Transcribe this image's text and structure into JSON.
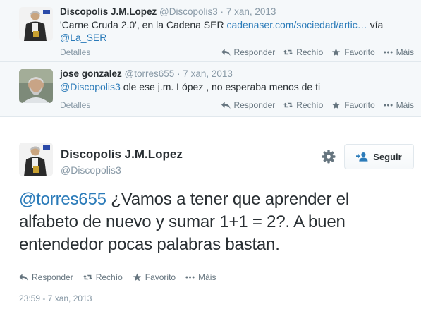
{
  "context_tweets": [
    {
      "fullname": "Discopolis J.M.Lopez",
      "username": "@Discopolis3",
      "separator": "·",
      "time": "7 xan, 2013",
      "text_prefix": "'Carne Cruda 2.0', en la Cadena SER ",
      "link": "cadenaser.com/sociedad/artic…",
      "text_via": " vía",
      "mention": "@La_SER",
      "details": "Detalles",
      "actions": {
        "reply": "Responder",
        "retweet": "Rechío",
        "favorite": "Favorito",
        "more": "Máis"
      }
    },
    {
      "fullname": "jose gonzalez",
      "username": "@torres655",
      "separator": "·",
      "time": "7 xan, 2013",
      "mention": "@Discopolis3",
      "text": " ole ese j.m. López , no esperaba menos de ti",
      "details": "Detalles",
      "actions": {
        "reply": "Responder",
        "retweet": "Rechío",
        "favorite": "Favorito",
        "more": "Máis"
      }
    }
  ],
  "main_tweet": {
    "fullname": "Discopolis J.M.Lopez",
    "username": "@Discopolis3",
    "follow_label": "Seguir",
    "mention": "@torres655",
    "text": " ¿Vamos a tener que aprender el alfabeto de nuevo y sumar 1+1 = 2?. A buen entendedor pocas palabras bastan.",
    "actions": {
      "reply": "Responder",
      "retweet": "Rechío",
      "favorite": "Favorito",
      "more": "Máis"
    },
    "timestamp": "23:59 - 7 xan, 2013"
  },
  "colors": {
    "link": "#2b7bb9",
    "secondary": "#8899a6",
    "context_bg": "#f5f8fa",
    "border": "#e1e8ed"
  },
  "icons": [
    "reply-icon",
    "retweet-icon",
    "favorite-star-icon",
    "more-dots-icon",
    "gear-icon",
    "follow-person-plus-icon"
  ]
}
